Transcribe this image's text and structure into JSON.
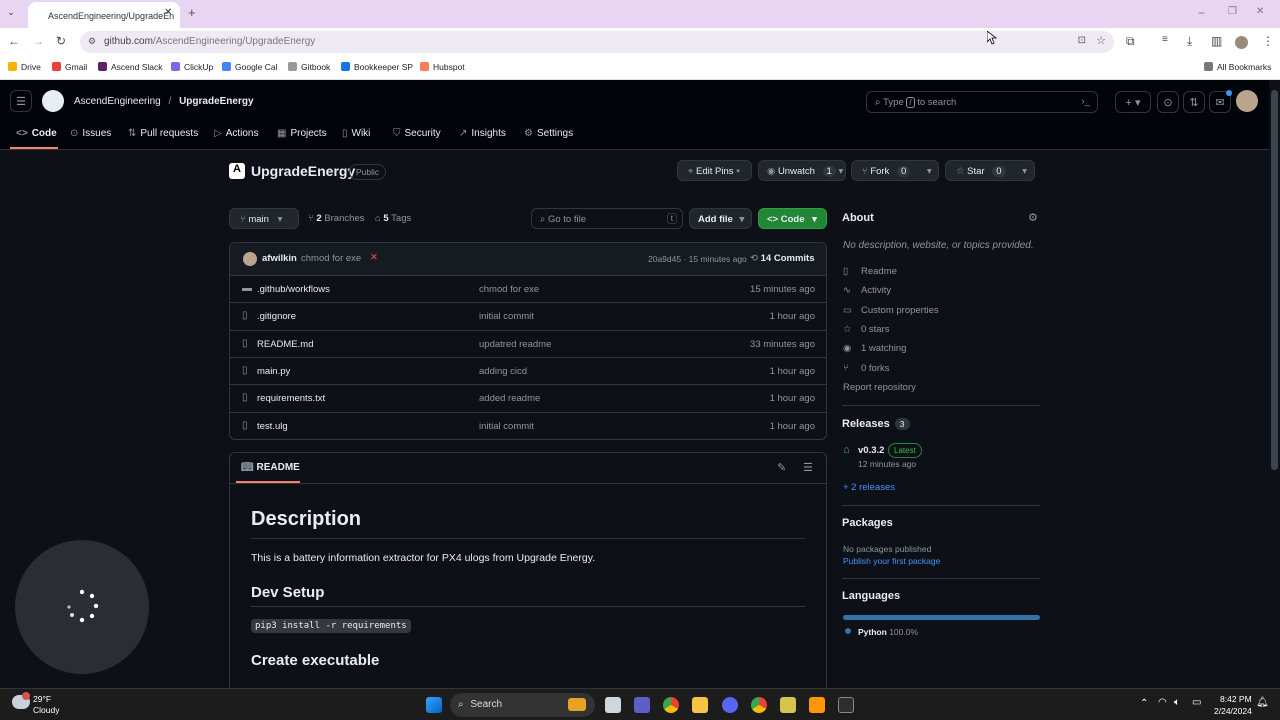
{
  "browser": {
    "tab_title": "AscendEngineering/UpgradeEn",
    "url_host": "github.com",
    "url_path": "/AscendEngineering/UpgradeEnergy",
    "bookmarks": [
      "Drive",
      "Gmail",
      "Ascend Slack",
      "ClickUp",
      "Google Cal",
      "Gitbook",
      "Bookkeeper SP",
      "Hubspot"
    ],
    "all_bookmarks": "All Bookmarks"
  },
  "gh": {
    "owner": "AscendEngineering",
    "sep": "/",
    "repo": "UpgradeEnergy",
    "search_prefix": "Type",
    "search_key": "/",
    "search_suffix": "to search",
    "tabs": [
      "Code",
      "Issues",
      "Pull requests",
      "Actions",
      "Projects",
      "Wiki",
      "Security",
      "Insights",
      "Settings"
    ]
  },
  "repo": {
    "name": "UpgradeEnergy",
    "visibility": "Public",
    "edit_pins": "Edit Pins",
    "unwatch": "Unwatch",
    "watch_count": "1",
    "fork": "Fork",
    "fork_count": "0",
    "star": "Star",
    "star_count": "0",
    "branch": "main",
    "branches_count": "2",
    "branches_label": "Branches",
    "tags_count": "5",
    "tags_label": "Tags",
    "goto_placeholder": "Go to file",
    "goto_key": "t",
    "add_file": "Add file",
    "code_btn": "Code"
  },
  "commit": {
    "author": "afwilkin",
    "message": "chmod for exe",
    "status": "✕",
    "hash": "20a9d45",
    "time": "15 minutes ago",
    "count": "14",
    "count_label": "Commits"
  },
  "files": [
    {
      "name": ".github/workflows",
      "type": "folder",
      "msg": "chmod for exe",
      "time": "15 minutes ago"
    },
    {
      "name": ".gitignore",
      "type": "file",
      "msg": "initial commit",
      "time": "1 hour ago"
    },
    {
      "name": "README.md",
      "type": "file",
      "msg": "updatred readme",
      "time": "33 minutes ago"
    },
    {
      "name": "main.py",
      "type": "file",
      "msg": "adding cicd",
      "time": "1 hour ago"
    },
    {
      "name": "requirements.txt",
      "type": "file",
      "msg": "added readme",
      "time": "1 hour ago"
    },
    {
      "name": "test.ulg",
      "type": "file",
      "msg": "initial commit",
      "time": "1 hour ago"
    }
  ],
  "readme": {
    "tab": "README",
    "h1": "Description",
    "p": "This is a battery information extractor for PX4 ulogs from Upgrade Energy.",
    "h2": "Dev Setup",
    "code": "pip3 install -r requirements",
    "h3": "Create executable"
  },
  "about": {
    "title": "About",
    "desc": "No description, website, or topics provided.",
    "items": [
      "Readme",
      "Activity",
      "Custom properties",
      "0 stars",
      "1 watching",
      "0 forks"
    ],
    "report": "Report repository"
  },
  "releases": {
    "title": "Releases",
    "count": "3",
    "version": "v0.3.2",
    "badge": "Latest",
    "time": "12 minutes ago",
    "more": "+ 2 releases"
  },
  "packages": {
    "title": "Packages",
    "none": "No packages published",
    "publish": "Publish your first package"
  },
  "languages": {
    "title": "Languages",
    "name": "Python",
    "pct": "100.0%",
    "fraction": 1.0,
    "color": "#3572a5"
  },
  "taskbar": {
    "temp": "29°F",
    "weather": "Cloudy",
    "search": "Search",
    "time": "8:42 PM",
    "date": "2/24/2024"
  },
  "colors": {
    "accent": "#238636",
    "link": "#4493f8",
    "bg": "#0d1117"
  }
}
